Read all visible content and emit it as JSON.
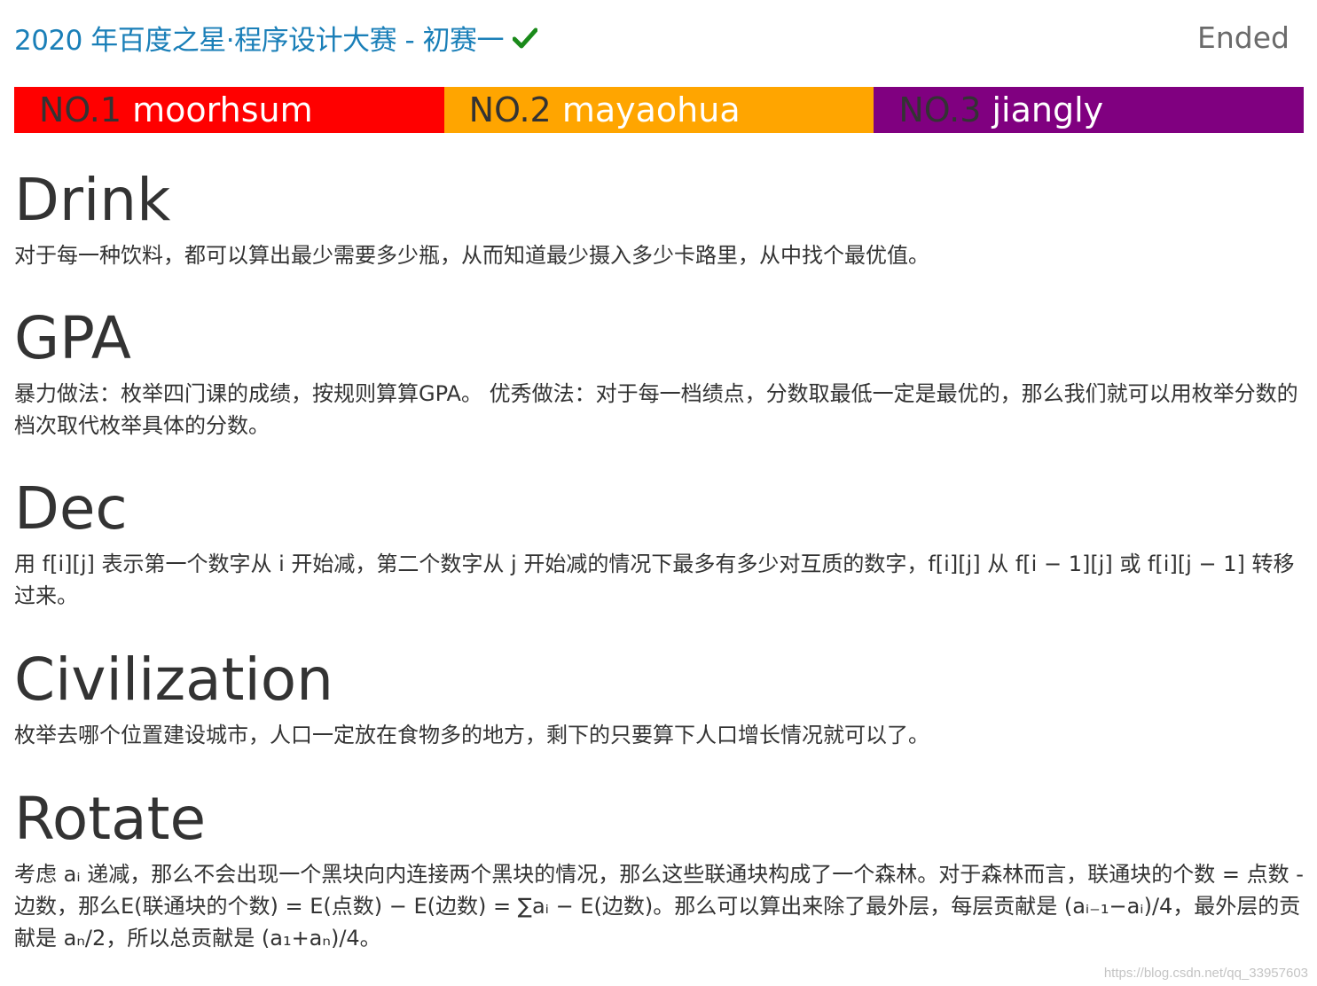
{
  "header": {
    "title": "2020 年百度之星·程序设计大赛 - 初赛一",
    "status": "Ended",
    "check_color": "#1a8a1a"
  },
  "ranking": [
    {
      "no": "NO.1",
      "name": "moorhsum",
      "color": "#ff0000"
    },
    {
      "no": "NO.2",
      "name": "mayaohua",
      "color": "#ffa500"
    },
    {
      "no": "NO.3",
      "name": "jiangly",
      "color": "#800080"
    }
  ],
  "problems": [
    {
      "title": "Drink",
      "text": "对于每一种饮料，都可以算出最少需要多少瓶，从而知道最少摄入多少卡路里，从中找个最优值。"
    },
    {
      "title": "GPA",
      "text": "暴力做法：枚举四门课的成绩，按规则算算GPA。 优秀做法：对于每一档绩点，分数取最低一定是最优的，那么我们就可以用枚举分数的档次取代枚举具体的分数。"
    },
    {
      "title": "Dec",
      "text": "用 f[i][j] 表示第一个数字从 i 开始减，第二个数字从 j 开始减的情况下最多有多少对互质的数字，f[i][j] 从 f[i − 1][j] 或 f[i][j − 1] 转移过来。"
    },
    {
      "title": "Civilization",
      "text": "枚举去哪个位置建设城市，人口一定放在食物多的地方，剩下的只要算下人口增长情况就可以了。"
    },
    {
      "title": "Rotate",
      "text": "考虑 aᵢ 递减，那么不会出现一个黑块向内连接两个黑块的情况，那么这些联通块构成了一个森林。对于森林而言，联通块的个数 = 点数 - 边数，那么E(联通块的个数) = E(点数) − E(边数) = ∑aᵢ − E(边数)。那么可以算出来除了最外层，每层贡献是 (aᵢ₋₁−aᵢ)/4，最外层的贡献是 aₙ/2，所以总贡献是 (a₁+aₙ)/4。"
    }
  ],
  "watermark": "https://blog.csdn.net/qq_33957603"
}
